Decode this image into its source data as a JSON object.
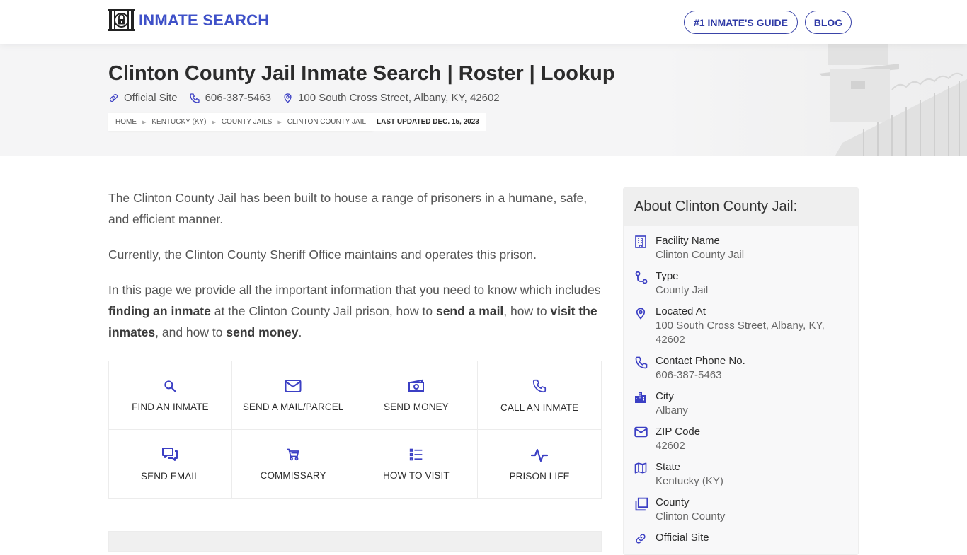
{
  "header": {
    "logo_text": "INMATE SEARCH",
    "nav": [
      {
        "label": "#1 INMATE'S GUIDE"
      },
      {
        "label": "BLOG"
      }
    ]
  },
  "hero": {
    "title": "Clinton County Jail Inmate Search | Roster | Lookup",
    "meta": {
      "official_site": "Official Site",
      "phone": "606-387-5463",
      "address": "100 South Cross Street, Albany, KY, 42602"
    },
    "breadcrumbs": [
      "HOME",
      "KENTUCKY (KY)",
      "COUNTY JAILS",
      "CLINTON COUNTY JAIL"
    ],
    "last_updated": "LAST UPDATED DEC. 15, 2023"
  },
  "content": {
    "p1": "The Clinton County Jail has been built to house a range of prisoners in a humane, safe, and efficient manner.",
    "p2": "Currently, the Clinton County Sheriff Office maintains and operates this prison.",
    "p3": {
      "t1": "In this page we provide all the important information that you need to know which includes ",
      "b1": "finding an inmate",
      "t2": " at the Clinton County Jail prison, how to ",
      "b2": "send a mail",
      "t3": ", how to ",
      "b3": "visit the inmates",
      "t4": ", and how to ",
      "b4": "send money",
      "t5": "."
    }
  },
  "tiles": [
    {
      "label": "FIND AN INMATE",
      "icon": "search-icon"
    },
    {
      "label": "SEND A MAIL/PARCEL",
      "icon": "envelope-icon"
    },
    {
      "label": "SEND MONEY",
      "icon": "money-icon"
    },
    {
      "label": "CALL AN INMATE",
      "icon": "phone-icon"
    },
    {
      "label": "SEND EMAIL",
      "icon": "chat-icon"
    },
    {
      "label": "COMMISSARY",
      "icon": "cart-icon"
    },
    {
      "label": "HOW TO VISIT",
      "icon": "list-icon"
    },
    {
      "label": "PRISON LIFE",
      "icon": "pulse-icon"
    }
  ],
  "sidebar": {
    "title": "About Clinton County Jail:",
    "facts": [
      {
        "label": "Facility Name",
        "value": "Clinton County Jail",
        "icon": "building-icon"
      },
      {
        "label": "Type",
        "value": "County Jail",
        "icon": "route-icon"
      },
      {
        "label": "Located At",
        "value": "100 South Cross Street, Albany, KY, 42602",
        "icon": "map-pin-icon"
      },
      {
        "label": "Contact Phone No.",
        "value": "606-387-5463",
        "icon": "phone-icon"
      },
      {
        "label": "City",
        "value": "Albany",
        "icon": "city-icon"
      },
      {
        "label": "ZIP Code",
        "value": "42602",
        "icon": "envelope-icon"
      },
      {
        "label": "State",
        "value": "Kentucky (KY)",
        "icon": "map-icon"
      },
      {
        "label": "County",
        "value": "Clinton County",
        "icon": "copy-icon"
      },
      {
        "label": "Official Site",
        "value": "",
        "icon": "link-icon"
      }
    ]
  },
  "colors": {
    "accent": "#3f51c8",
    "icon": "#3b3fc4",
    "hero_bg": "#f5f5f6"
  }
}
